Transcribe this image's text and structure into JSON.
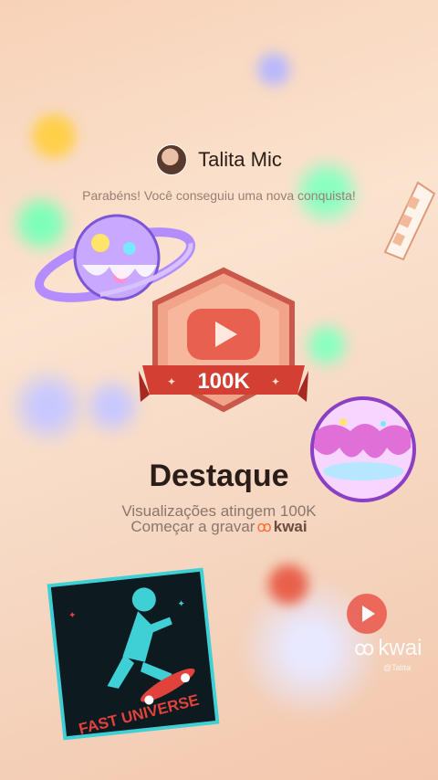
{
  "header": {
    "username": "Talita Mic",
    "congrats_text": "Parabéns! Você conseguiu uma nova conquista!"
  },
  "badge": {
    "label": "100K"
  },
  "achievement": {
    "title": "Destaque",
    "subtitle": "Visualizações atingem 100K",
    "record_text": "Começar a gravar",
    "brand": "kwai"
  },
  "sticker": {
    "text": "FAST UNIVERSE"
  },
  "watermark": {
    "brand": "kwai",
    "handle": "@Talita"
  },
  "colors": {
    "background": "#f8dcc6",
    "badge_red": "#d94a3c",
    "accent_orange": "#ff6a2b",
    "sticker_teal": "#3fd0d6"
  }
}
